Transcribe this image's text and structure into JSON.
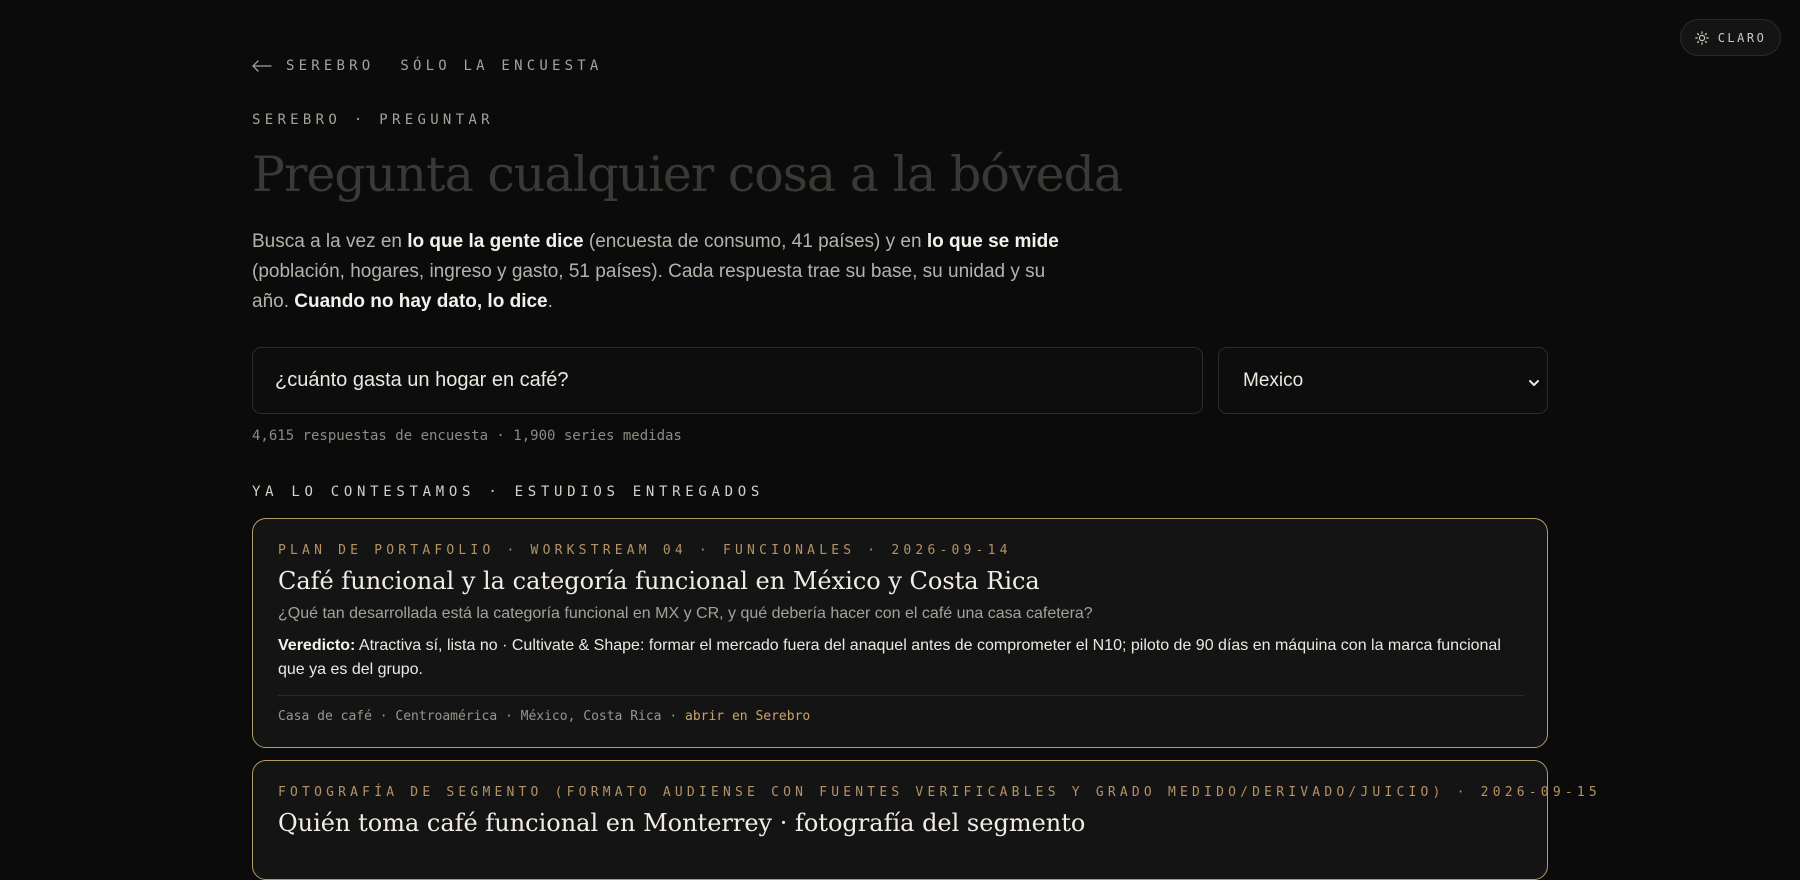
{
  "theme_toggle": {
    "icon": "sun-icon",
    "label": "CLARO"
  },
  "nav": {
    "back_icon": "arrow-left-icon",
    "back_label": "SEREBRO",
    "survey_only_label": "SÓLO LA ENCUESTA"
  },
  "header": {
    "eyebrow": "SEREBRO · PREGUNTAR",
    "title": "Pregunta cualquier cosa a la bóveda"
  },
  "intro": {
    "part1": "Busca a la vez en ",
    "strong1": "lo que la gente dice",
    "part2": " (encuesta de consumo, 41 países) y en ",
    "strong2": "lo que se mide",
    "part3": " (población, hogares, ingreso y gasto, 51 países). Cada respuesta trae su base, su unidad y su año. ",
    "strong3": "Cuando no hay dato, lo dice",
    "part4": "."
  },
  "search": {
    "query_value": "¿cuánto gasta un hogar en café?",
    "country_selected": "Mexico",
    "chevron_icon": "chevron-down-icon"
  },
  "counts": "4,615 respuestas de encuesta · 1,900 series medidas",
  "section_label": "YA LO CONTESTAMOS · ESTUDIOS ENTREGADOS",
  "studies": [
    {
      "meta": "PLAN DE PORTAFOLIO · WORKSTREAM 04 · FUNCIONALES · 2026-09-14",
      "title": "Café funcional y la categoría funcional en México y Costa Rica",
      "question": "¿Qué tan desarrollada está la categoría funcional en MX y CR, y qué debería hacer con el café una casa cafetera?",
      "verdict_label": "Veredicto:",
      "verdict_text": " Atractiva sí, lista no · Cultivate & Shape: formar el mercado fuera del anaquel antes de comprometer el N10; piloto de 90 días en máquina con la marca funcional que ya es del grupo.",
      "footer_text": "Casa de café · Centroamérica · México, Costa Rica · ",
      "open_link": "abrir en Serebro"
    },
    {
      "meta": "FOTOGRAFÍA DE SEGMENTO (FORMATO AUDIENSE CON FUENTES VERIFICABLES Y GRADO MEDIDO/DERIVADO/JUICIO) · 2026-09-15",
      "title": "Quién toma café funcional en Monterrey · fotografía del segmento"
    }
  ],
  "colors": {
    "background": "#0b0b0b",
    "accent_gold": "#b89a67",
    "card_background": "#141414"
  }
}
